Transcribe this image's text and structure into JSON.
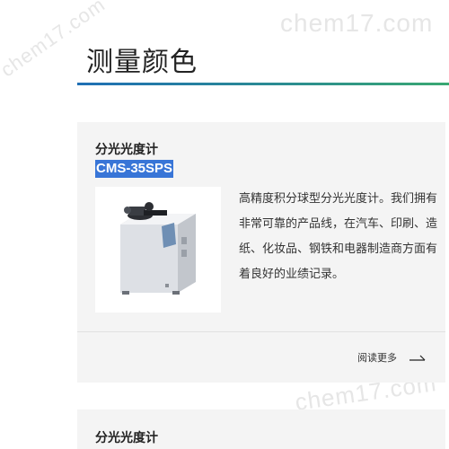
{
  "watermark": {
    "text": "chem17.com"
  },
  "header": {
    "title": "测量颜色"
  },
  "cards": [
    {
      "category": "分光光度计",
      "model": "CMS-35SPS",
      "description": "高精度积分球型分光光度计。我们拥有非常可靠的产品线，在汽车、印刷、造纸、化妆品、钢铁和电器制造商方面有着良好的业绩记录。",
      "read_more": "阅读更多",
      "image_icon": "spectrophotometer-instrument"
    },
    {
      "category": "分光光度计"
    }
  ],
  "colors": {
    "accent_blue": "#1f6fb5",
    "accent_green": "#3aa872",
    "highlight": "#3875d7",
    "card_bg": "#f4f4f4"
  }
}
